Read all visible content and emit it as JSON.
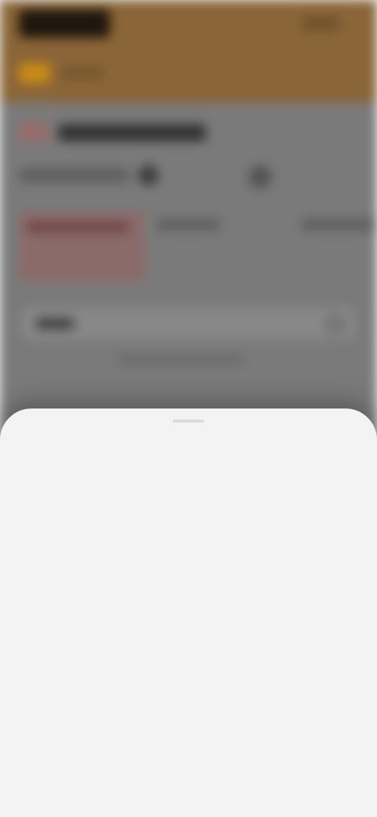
{
  "header": {
    "logo_text": "",
    "top_right_link": "",
    "location_label": ""
  },
  "store": {
    "title": "",
    "meta_text": ""
  },
  "tabs": [
    {
      "label": ""
    },
    {
      "label": ""
    },
    {
      "label": ""
    }
  ],
  "search": {
    "label": ""
  },
  "sheet": {
    "title": "",
    "options": [
      {
        "label": ""
      },
      {
        "label": ""
      },
      {
        "label": ""
      },
      {
        "label": ""
      },
      {
        "label": ""
      },
      {
        "label": ""
      }
    ]
  },
  "colors": {
    "header_bg": "#8a6537",
    "accent": "#c98a17",
    "overlay": "#7a7a7a",
    "sheet_bg": "#f3f3f3"
  }
}
